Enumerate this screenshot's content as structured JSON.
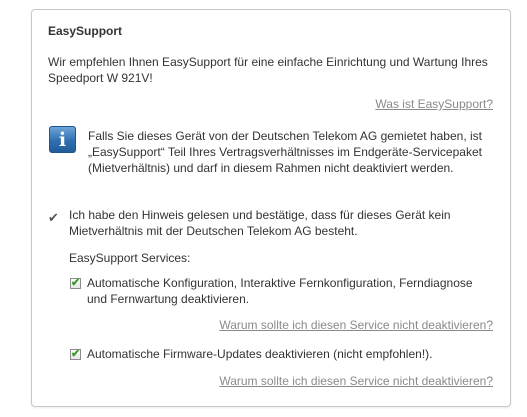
{
  "panel": {
    "title": "EasySupport",
    "intro": "Wir empfehlen Ihnen EasySupport für eine einfache Einrichtung und Wartung Ihres Speedport W 921V!",
    "help_link": "Was ist EasySupport?"
  },
  "info": {
    "icon": "info-icon",
    "icon_glyph": "i",
    "text": "Falls Sie dieses Gerät von der Deutschen Telekom AG gemietet haben, ist „EasySupport“ Teil Ihres Vertragsverhältnisses im Endgeräte-Servicepaket (Mietverhältnis) und darf in diesem Rahmen nicht deaktiviert werden."
  },
  "confirmation": {
    "checkmark": "✔",
    "text": "Ich habe den Hinweis gelesen und bestätige, dass für dieses Gerät kein Mietverhältnis mit der Deutschen Telekom AG besteht."
  },
  "services": {
    "heading": "EasySupport Services:",
    "items": [
      {
        "checked": true,
        "check_glyph": "✔",
        "label": "Automatische Konfiguration, Interaktive Fernkonfiguration, Ferndiagnose und Fernwartung deaktivieren.",
        "link": "Warum sollte ich diesen Service nicht deaktivieren?"
      },
      {
        "checked": true,
        "check_glyph": "✔",
        "label": "Automatische Firmware-Updates deaktivieren (nicht empfohlen!).",
        "link": "Warum sollte ich diesen Service nicht deaktivieren?"
      }
    ]
  },
  "colors": {
    "link": "#8a8a8a",
    "checkbox_check": "#3c9a2c",
    "info_icon": "#2f6fb0"
  }
}
